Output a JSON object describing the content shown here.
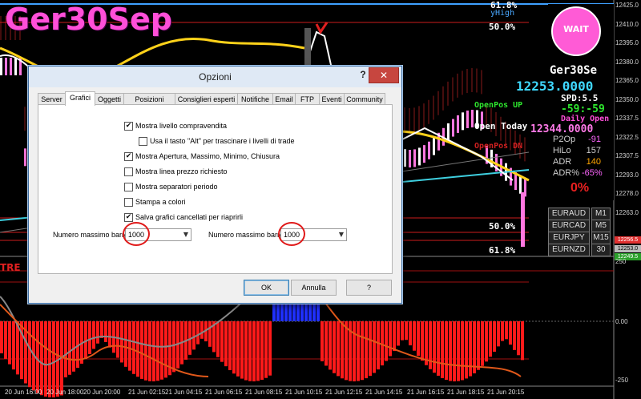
{
  "chart": {
    "symbol_banner": "Ger30Sep",
    "fib_labels": [
      "61.8%",
      "50.0%",
      "50.0%",
      "61.8%"
    ],
    "yhigh_label": "yHigh",
    "price_axis": [
      "12425.0",
      "12410.0",
      "12395.0",
      "12380.0",
      "12365.0",
      "12350.0",
      "12337.5",
      "12322.5",
      "12307.5",
      "12293.0",
      "12278.0",
      "12263.0"
    ],
    "price_tags": {
      "red": "12256.5",
      "gray": "12253.0",
      "green": "12249.5"
    },
    "time_axis": [
      "20 Jun 16:00",
      "20 Jun 18:00",
      "20 Jun 20:00",
      "21 Jun 02:15",
      "21 Jun 04:15",
      "21 Jun 06:15",
      "21 Jun 08:15",
      "21 Jun 10:15",
      "21 Jun 12:15",
      "21 Jun 14:15",
      "21 Jun 16:15",
      "21 Jun 18:15",
      "21 Jun 20:15"
    ],
    "osc_axis": {
      "top": "250",
      "mid": "0.00",
      "bottom": "-250"
    },
    "trend_label": "TRE",
    "colors": {
      "bull": "#ff77e0",
      "bear": "#ffffff",
      "hist_red": "#ff1a1a",
      "hist_blue": "#2030ff",
      "ma_yellow": "#ffd21a",
      "line_cyan": "#3fd0e0"
    }
  },
  "side_panel": {
    "wait_label": "WAIT",
    "symbol": "Ger30Se",
    "price": "12253.0000",
    "spread": "SPD:5.5",
    "timer": "-59:-59",
    "daily_open": "Daily Open",
    "daily_open_value": "12344.0000",
    "open_today": "Open Today",
    "openpos_up": "OpenPos UP",
    "openpos_dn": "OpenPos DN",
    "stats": [
      {
        "label": "P2Op",
        "value": "-91",
        "color": "#ff66ff"
      },
      {
        "label": "HiLo",
        "value": "157",
        "color": "#cfcfcf"
      },
      {
        "label": "ADR",
        "value": "140",
        "color": "#ffa500"
      },
      {
        "label": "ADR%",
        "value": "-65%",
        "color": "#ff66ff"
      }
    ],
    "percent": "0%",
    "symbols": [
      {
        "name": "EURAUD",
        "tf": "M1"
      },
      {
        "name": "EURCAD",
        "tf": "M5"
      },
      {
        "name": "EURJPY",
        "tf": "M15"
      },
      {
        "name": "EURNZD",
        "tf": "30"
      }
    ]
  },
  "dialog": {
    "title": "Opzioni",
    "help": "?",
    "close": "✕",
    "tabs": [
      "Server",
      "Grafici",
      "Oggetti",
      "Posizioni aperte",
      "Consiglieri esperti",
      "Notifiche",
      "Email",
      "FTP",
      "Eventi",
      "Community"
    ],
    "active_tab": "Grafici",
    "options": [
      {
        "label": "Mostra livello compravendita",
        "checked": true
      },
      {
        "label": "Usa il tasto \"Alt\" per trascinare i livelli di trade",
        "checked": false
      },
      {
        "label": "Mostra Apertura, Massimo, Minimo, Chiusura",
        "checked": true
      },
      {
        "label": "Mostra linea prezzo richiesto",
        "checked": false
      },
      {
        "label": "Mostra separatori periodo",
        "checked": false
      },
      {
        "label": "Stampa a colori",
        "checked": false
      },
      {
        "label": "Salva grafici cancellati per riaprirli",
        "checked": true
      }
    ],
    "max_bars_label_1": "Numero massimo barre",
    "max_bars_value_1": "1000",
    "max_bars_label_2": "Numero massimo barre",
    "max_bars_value_2": "1000",
    "ok": "OK",
    "cancel": "Annulla",
    "help_button": "?"
  }
}
